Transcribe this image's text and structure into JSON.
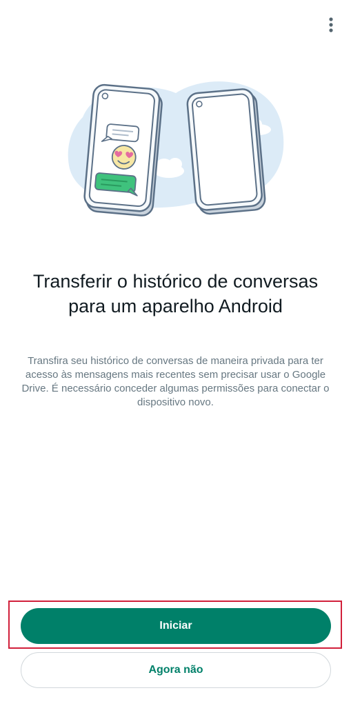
{
  "menu": {
    "icon": "more-vert-icon"
  },
  "illustration": {
    "icons": [
      "phone-icon",
      "chat-bubble-icon",
      "heart-eyes-emoji-icon",
      "cloud-icon"
    ],
    "colors": {
      "blob": "#dcebf7",
      "phone_outline": "#5b7087",
      "phone_fill": "#f6f9fb",
      "bubble_green": "#3fc27d",
      "emoji_yellow": "#f7e7a4",
      "hearts": "#e46ba0"
    }
  },
  "content": {
    "title": "Transferir o histórico de conversas para um aparelho Android",
    "description": "Transfira seu histórico de conversas de maneira privada para ter acesso às mensagens mais recentes sem precisar usar o Google Drive. É necessário conceder algumas permissões para conectar o dispositivo novo."
  },
  "actions": {
    "primary_label": "Iniciar",
    "secondary_label": "Agora não"
  },
  "colors": {
    "accent": "#008069",
    "title_text": "#111b21",
    "body_text": "#667781",
    "highlight": "#d11f3a"
  }
}
